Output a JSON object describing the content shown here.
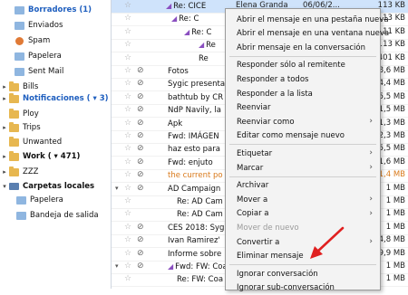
{
  "folders": [
    {
      "name": "folder-borradores",
      "label": "Borradores (1)",
      "style": "blue",
      "icon": "special",
      "twisty": ""
    },
    {
      "name": "folder-enviados",
      "label": "Enviados",
      "style": "",
      "icon": "special",
      "twisty": ""
    },
    {
      "name": "folder-spam",
      "label": "Spam",
      "style": "",
      "icon": "spam",
      "twisty": ""
    },
    {
      "name": "folder-papelera",
      "label": "Papelera",
      "style": "",
      "icon": "special",
      "twisty": ""
    },
    {
      "name": "folder-sent-mail",
      "label": "Sent Mail",
      "style": "",
      "icon": "special",
      "twisty": ""
    },
    {
      "name": "folder-bills",
      "label": "Bills",
      "style": "",
      "icon": "folder",
      "twisty": "▸"
    },
    {
      "name": "folder-notificaciones",
      "label": "Notificaciones ( ▾ 3)",
      "style": "blue",
      "icon": "folder",
      "twisty": "▸"
    },
    {
      "name": "folder-ploy",
      "label": "Ploy",
      "style": "",
      "icon": "folder",
      "twisty": ""
    },
    {
      "name": "folder-trips",
      "label": "Trips",
      "style": "",
      "icon": "folder",
      "twisty": "▸"
    },
    {
      "name": "folder-unwanted",
      "label": "Unwanted",
      "style": "",
      "icon": "folder",
      "twisty": ""
    },
    {
      "name": "folder-work",
      "label": "Work ( ▾ 471)",
      "style": "bold",
      "icon": "folder",
      "twisty": "▸"
    },
    {
      "name": "folder-zzz",
      "label": "ZZZ",
      "style": "",
      "icon": "folder",
      "twisty": "▸"
    },
    {
      "name": "folder-carpetas-locales",
      "label": "Carpetas locales",
      "style": "bold",
      "icon": "local",
      "twisty": "▾"
    },
    {
      "name": "folder-local-papelera",
      "label": "Papelera",
      "style": "",
      "icon": "special",
      "twisty": ""
    },
    {
      "name": "folder-bandeja-salida",
      "label": "Bandeja de salida",
      "style": "",
      "icon": "special",
      "twisty": ""
    }
  ],
  "messages": [
    {
      "subject": "Re: CICE",
      "indent": 60,
      "reply": true,
      "clip": false,
      "twisty": "",
      "size": "113 KB",
      "extra": "Elena Granda",
      "extra2": "06/06/2...",
      "selected": true,
      "orange": false
    },
    {
      "subject": "Re: C",
      "indent": 66,
      "reply": true,
      "clip": false,
      "twisty": "",
      "size": "113 KB",
      "extra": "",
      "extra2": "",
      "selected": false,
      "orange": false
    },
    {
      "subject": "Re: C",
      "indent": 80,
      "reply": true,
      "clip": false,
      "twisty": "",
      "size": "111 KB",
      "extra": "",
      "extra2": "",
      "selected": false,
      "orange": false
    },
    {
      "subject": "Re",
      "indent": 96,
      "reply": true,
      "clip": false,
      "twisty": "",
      "size": "113 KB",
      "extra": "",
      "extra2": "",
      "selected": false,
      "orange": false
    },
    {
      "subject": "Re",
      "indent": 96,
      "reply": false,
      "clip": false,
      "twisty": "",
      "size": "401 KB",
      "extra": "",
      "extra2": "",
      "selected": false,
      "orange": false
    },
    {
      "subject": "Fotos",
      "indent": 62,
      "reply": false,
      "clip": true,
      "twisty": "",
      "size": "8,6 MB",
      "extra": "",
      "extra2": "",
      "selected": false,
      "orange": false
    },
    {
      "subject": "Sygic presenta",
      "indent": 62,
      "reply": false,
      "clip": true,
      "twisty": "",
      "size": "4,4 MB",
      "extra": "",
      "extra2": "",
      "selected": false,
      "orange": false
    },
    {
      "subject": "bathtub by CR",
      "indent": 62,
      "reply": false,
      "clip": true,
      "twisty": "",
      "size": "5,5 MB",
      "extra": "",
      "extra2": "",
      "selected": false,
      "orange": false
    },
    {
      "subject": "NdP Navily, la",
      "indent": 62,
      "reply": false,
      "clip": true,
      "twisty": "",
      "size": "1,5 MB",
      "extra": "",
      "extra2": "",
      "selected": false,
      "orange": false
    },
    {
      "subject": "Apk",
      "indent": 62,
      "reply": false,
      "clip": true,
      "twisty": "",
      "size": "1,3 MB",
      "extra": "",
      "extra2": "",
      "selected": false,
      "orange": false
    },
    {
      "subject": "Fwd: IMÁGEN",
      "indent": 62,
      "reply": false,
      "clip": true,
      "twisty": "",
      "size": "2,3 MB",
      "extra": "",
      "extra2": "",
      "selected": false,
      "orange": false
    },
    {
      "subject": "haz esto para",
      "indent": 62,
      "reply": false,
      "clip": true,
      "twisty": "",
      "size": "5,5 MB",
      "extra": "",
      "extra2": "",
      "selected": false,
      "orange": false
    },
    {
      "subject": "Fwd: enjuto",
      "indent": 62,
      "reply": false,
      "clip": true,
      "twisty": "",
      "size": "1,6 MB",
      "extra": "",
      "extra2": "",
      "selected": false,
      "orange": false
    },
    {
      "subject": "the current po",
      "indent": 62,
      "reply": false,
      "clip": true,
      "twisty": "",
      "size": "1,4 MB",
      "extra": "",
      "extra2": "",
      "selected": false,
      "orange": true
    },
    {
      "subject": "AD Campaign",
      "indent": 62,
      "reply": false,
      "clip": true,
      "twisty": "▾",
      "size": "1 MB",
      "extra": "",
      "extra2": "",
      "selected": false,
      "orange": false
    },
    {
      "subject": "Re: AD Cam",
      "indent": 72,
      "reply": false,
      "clip": false,
      "twisty": "",
      "size": "1 MB",
      "extra": "",
      "extra2": "",
      "selected": false,
      "orange": false
    },
    {
      "subject": "Re: AD Cam",
      "indent": 72,
      "reply": false,
      "clip": false,
      "twisty": "",
      "size": "1 MB",
      "extra": "",
      "extra2": "",
      "selected": false,
      "orange": false
    },
    {
      "subject": "CES 2018: Sygi",
      "indent": 62,
      "reply": false,
      "clip": true,
      "twisty": "",
      "size": "1 MB",
      "extra": "",
      "extra2": "",
      "selected": false,
      "orange": false
    },
    {
      "subject": "Ivan Ramirez'",
      "indent": 62,
      "reply": false,
      "clip": true,
      "twisty": "",
      "size": "4,8 MB",
      "extra": "",
      "extra2": "",
      "selected": false,
      "orange": false
    },
    {
      "subject": "Informe sobre",
      "indent": 62,
      "reply": false,
      "clip": true,
      "twisty": "",
      "size": "9,9 MB",
      "extra": "",
      "extra2": "",
      "selected": false,
      "orange": false
    },
    {
      "subject": "Fwd: FW: Coa",
      "indent": 62,
      "reply": true,
      "clip": true,
      "twisty": "▾",
      "size": "1 MB",
      "extra": "",
      "extra2": "",
      "selected": false,
      "orange": false
    },
    {
      "subject": "Re: FW: Coa",
      "indent": 72,
      "reply": false,
      "clip": false,
      "twisty": "",
      "size": "1 MB",
      "extra": "",
      "extra2": "",
      "selected": false,
      "orange": false
    }
  ],
  "context_menu": {
    "items": [
      {
        "label": "Abrir el mensaje en una pestaña nueva",
        "submenu": false,
        "disabled": false,
        "sep_after": false
      },
      {
        "label": "Abrir el mensaje en una ventana nueva",
        "submenu": false,
        "disabled": false,
        "sep_after": false
      },
      {
        "label": "Abrir mensaje en la conversación",
        "submenu": false,
        "disabled": false,
        "sep_after": true
      },
      {
        "label": "Responder sólo al remitente",
        "submenu": false,
        "disabled": false,
        "sep_after": false
      },
      {
        "label": "Responder a todos",
        "submenu": false,
        "disabled": false,
        "sep_after": false
      },
      {
        "label": "Responder a la lista",
        "submenu": false,
        "disabled": false,
        "sep_after": false
      },
      {
        "label": "Reenviar",
        "submenu": false,
        "disabled": false,
        "sep_after": false
      },
      {
        "label": "Reenviar como",
        "submenu": true,
        "disabled": false,
        "sep_after": false
      },
      {
        "label": "Editar como mensaje nuevo",
        "submenu": false,
        "disabled": false,
        "sep_after": true
      },
      {
        "label": "Etiquetar",
        "submenu": true,
        "disabled": false,
        "sep_after": false
      },
      {
        "label": "Marcar",
        "submenu": true,
        "disabled": false,
        "sep_after": true
      },
      {
        "label": "Archivar",
        "submenu": false,
        "disabled": false,
        "sep_after": false
      },
      {
        "label": "Mover a",
        "submenu": true,
        "disabled": false,
        "sep_after": false
      },
      {
        "label": "Copiar a",
        "submenu": true,
        "disabled": false,
        "sep_after": false
      },
      {
        "label": "Mover de nuevo",
        "submenu": false,
        "disabled": true,
        "sep_after": false
      },
      {
        "label": "Convertir a",
        "submenu": true,
        "disabled": false,
        "sep_after": false
      },
      {
        "label": "Eliminar mensaje",
        "submenu": false,
        "disabled": false,
        "sep_after": true
      },
      {
        "label": "Ignorar conversación",
        "submenu": false,
        "disabled": false,
        "sep_after": false
      },
      {
        "label": "Ignorar sub-conversación",
        "submenu": false,
        "disabled": false,
        "sep_after": false
      }
    ]
  },
  "colors": {
    "accent": "#1f5fbf",
    "selected_row": "#cfe3fb",
    "annotation": "#e02020",
    "orange_text": "#d9791a"
  }
}
